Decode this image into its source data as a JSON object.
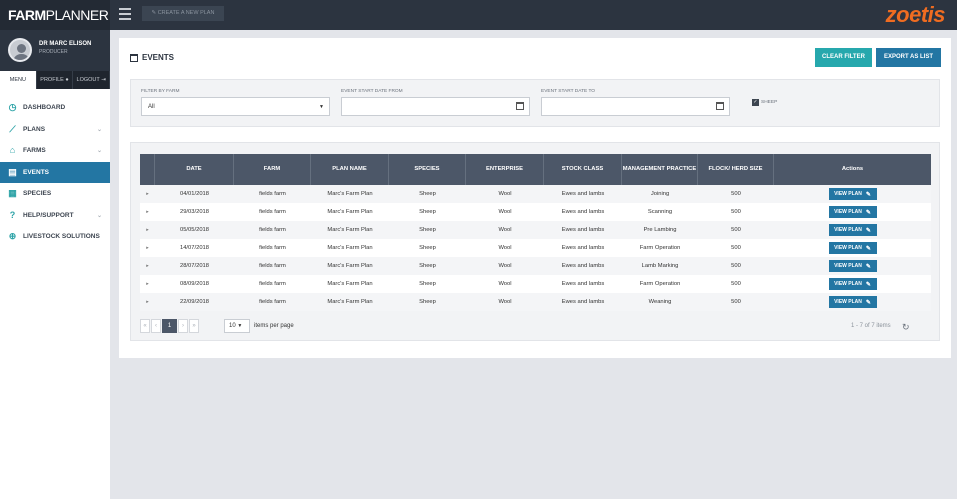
{
  "app": {
    "brand_bold": "FARM",
    "brand_thin": "PLANNER",
    "create_plan_label": "CREATE A NEW PLAN",
    "logo": "zoetis"
  },
  "user": {
    "name": "DR MARC ELISON",
    "role": "PRODUCER"
  },
  "menu_tabs": {
    "menu": "MENU",
    "profile": "PROFILE",
    "logout": "LOGOUT"
  },
  "sidebar": {
    "items": [
      {
        "label": "DASHBOARD",
        "icon": "gauge-icon",
        "glyph": "◷"
      },
      {
        "label": "PLANS",
        "icon": "chart-icon",
        "glyph": "⟋"
      },
      {
        "label": "FARMS",
        "icon": "home-icon",
        "glyph": "⌂"
      },
      {
        "label": "EVENTS",
        "icon": "calendar-icon",
        "glyph": "▤"
      },
      {
        "label": "SPECIES",
        "icon": "grid-icon",
        "glyph": "▦"
      },
      {
        "label": "HELP/SUPPORT",
        "icon": "question-icon",
        "glyph": "?"
      },
      {
        "label": "LIVESTOCK SOLUTIONS",
        "icon": "globe-icon",
        "glyph": "⊕"
      }
    ]
  },
  "page": {
    "title": "EVENTS",
    "clear_filter": "CLEAR FILTER",
    "export": "EXPORT AS LIST"
  },
  "filters": {
    "farm_label": "FILTER BY FARM",
    "farm_value": "All",
    "from_label": "EVENT START DATE FROM",
    "to_label": "EVENT START DATE TO",
    "sheep_label": "SHEEP"
  },
  "table": {
    "headers": [
      "DATE",
      "FARM",
      "PLAN NAME",
      "SPECIES",
      "ENTERPRISE",
      "STOCK CLASS",
      "MANAGEMENT PRACTICE",
      "FLOCK/ HERD SIZE",
      "Actions"
    ],
    "rows": [
      [
        "04/01/2018",
        "fields farm",
        "Marc's Farm Plan",
        "Sheep",
        "Wool",
        "Ewes and lambs",
        "Joining",
        "500"
      ],
      [
        "29/03/2018",
        "fields farm",
        "Marc's Farm Plan",
        "Sheep",
        "Wool",
        "Ewes and lambs",
        "Scanning",
        "500"
      ],
      [
        "05/05/2018",
        "fields farm",
        "Marc's Farm Plan",
        "Sheep",
        "Wool",
        "Ewes and lambs",
        "Pre Lambing",
        "500"
      ],
      [
        "14/07/2018",
        "fields farm",
        "Marc's Farm Plan",
        "Sheep",
        "Wool",
        "Ewes and lambs",
        "Farm Operation",
        "500"
      ],
      [
        "28/07/2018",
        "fields farm",
        "Marc's Farm Plan",
        "Sheep",
        "Wool",
        "Ewes and lambs",
        "Lamb Marking",
        "500"
      ],
      [
        "08/09/2018",
        "fields farm",
        "Marc's Farm Plan",
        "Sheep",
        "Wool",
        "Ewes and lambs",
        "Farm Operation",
        "500"
      ],
      [
        "22/09/2018",
        "fields farm",
        "Marc's Farm Plan",
        "Sheep",
        "Wool",
        "Ewes and lambs",
        "Weaning",
        "500"
      ]
    ],
    "view_label": "VIEW PLAN"
  },
  "pager": {
    "first": "«",
    "prev": "‹",
    "current": "1",
    "next": "›",
    "last": "»",
    "per_page": "10",
    "per_page_label": "items per page",
    "count": "1 - 7 of 7 items"
  }
}
